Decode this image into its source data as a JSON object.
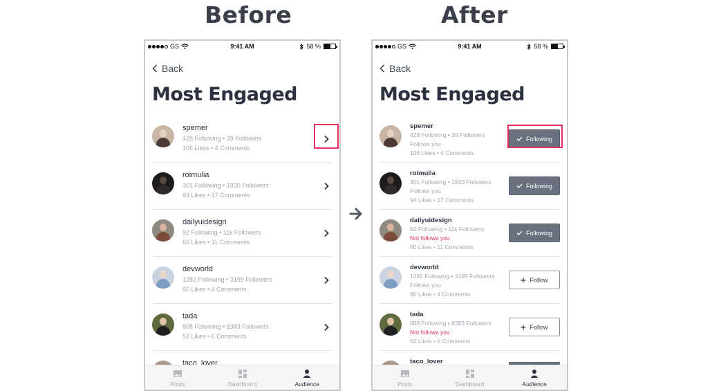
{
  "headings": {
    "before": "Before",
    "after": "After"
  },
  "statusbar": {
    "carrier": "GS",
    "time": "9:41 AM",
    "battery": "58 %"
  },
  "back_label": "Back",
  "page_title": "Most Engaged",
  "tabs": [
    {
      "label": "Posts",
      "icon": "image-icon"
    },
    {
      "label": "Dashboard",
      "icon": "dashboard-icon"
    },
    {
      "label": "Audience",
      "icon": "person-icon"
    }
  ],
  "before_users": [
    {
      "name": "spemer",
      "stats": "428 Following  •  39 Followers",
      "engagement": "106 Likes  •  4 Comments"
    },
    {
      "name": "roimulia",
      "stats": "301 Following  •  1930 Followers",
      "engagement": "94 Likes  •  17 Comments"
    },
    {
      "name": "dailyuidesign",
      "stats": "92 Following  •  11k Followers",
      "engagement": "60 Likes  •  11 Comments"
    },
    {
      "name": "devworld",
      "stats": "1282 Following  •  3195 Followers",
      "engagement": "60 Likes  •  4 Comments"
    },
    {
      "name": "tada",
      "stats": "808 Following  •  8383 Followers",
      "engagement": "52 Likes  •  6 Comments"
    },
    {
      "name": "taco_lover"
    }
  ],
  "after_users": [
    {
      "name": "spemer",
      "stats": "428 Following  •  39 Followers",
      "follow_status": "Follows you",
      "engagement": "106 Likes  •  4 Comments",
      "button": "Following"
    },
    {
      "name": "roimulia",
      "stats": "301 Following  •  1930 Followers",
      "follow_status": "Follows you",
      "engagement": "94 Likes  •  17 Comments",
      "button": "Following"
    },
    {
      "name": "dailyuidesign",
      "stats": "92 Following  •  11k Followers",
      "follow_status": "Not follows you",
      "engagement": "60 Likes  •  11 Comments",
      "button": "Following"
    },
    {
      "name": "devworld",
      "stats": "1282 Following  •  3195 Followers",
      "follow_status": "Follows you",
      "engagement": "60 Likes  •  4 Comments",
      "button": "Follow"
    },
    {
      "name": "tada",
      "stats": "808 Following  •  8383 Followers",
      "follow_status": "Not follows you",
      "engagement": "52 Likes  •  6 Comments",
      "button": "Follow"
    },
    {
      "name": "taco_lover"
    }
  ],
  "colors": {
    "accent": "#e8305d",
    "button_dark": "#6a717e",
    "text_dark": "#2c3140",
    "text_muted": "#a3a6ad"
  }
}
